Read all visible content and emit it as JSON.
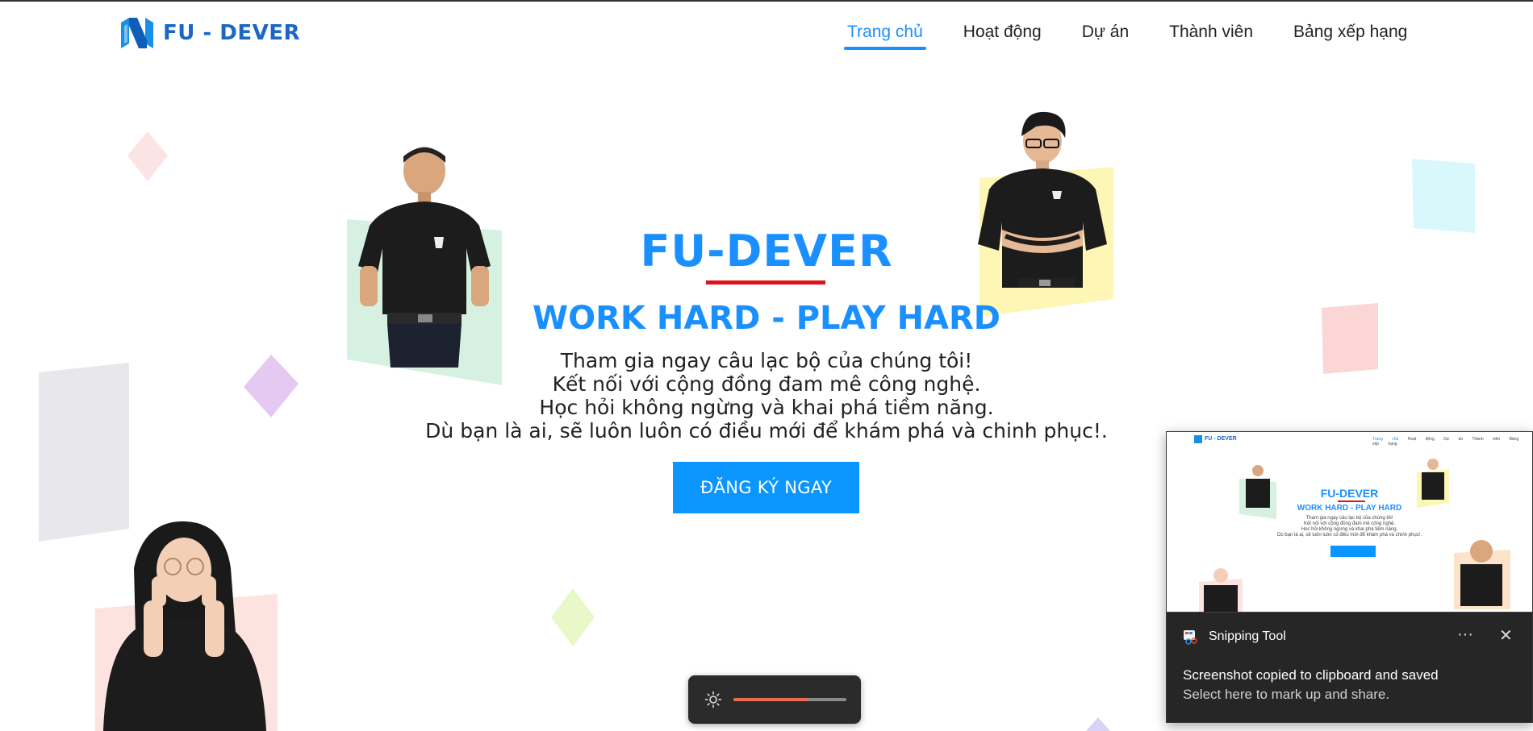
{
  "header": {
    "brand": "FU - DEVER",
    "nav": [
      {
        "label": "Trang chủ",
        "active": true
      },
      {
        "label": "Hoạt động",
        "active": false
      },
      {
        "label": "Dự án",
        "active": false
      },
      {
        "label": "Thành viên",
        "active": false
      },
      {
        "label": "Bảng xếp hạng",
        "active": false
      }
    ]
  },
  "hero": {
    "title": "FU-DEVER",
    "slogan": "WORK HARD - PLAY HARD",
    "lines": [
      "Tham gia ngay câu lạc bộ của chúng tôi!",
      "Kết nối với cộng đồng đam mê công nghệ.",
      "Học hỏi không ngừng và khai phá tiềm năng.",
      "Dù bạn là ai, sẽ luôn luôn có điều mới để khám phá và chinh phục!."
    ],
    "cta_label": "ĐĂNG KÝ NGAY"
  },
  "brightness": {
    "icon": "sun-icon",
    "level": 0.66,
    "fill_color": "#ec6a52"
  },
  "toast": {
    "app_name": "Snipping Tool",
    "more_icon": "···",
    "close_icon": "✕",
    "message": "Screenshot copied to clipboard and saved",
    "sub_message": "Select here to mark up and share."
  },
  "colors": {
    "brand_blue": "#1a90ff",
    "accent_red": "#e3101a",
    "logo_blue": "#1a67c4"
  }
}
